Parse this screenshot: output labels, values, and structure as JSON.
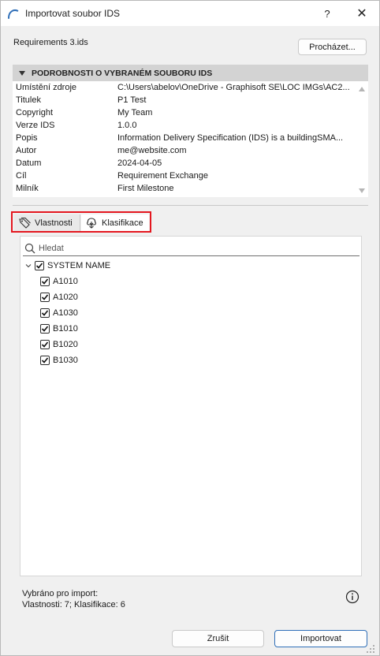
{
  "window": {
    "title": "Importovat soubor IDS",
    "help_label": "?",
    "close_label": "✕"
  },
  "file": {
    "name": "Requirements 3.ids",
    "browse_label": "Procházet..."
  },
  "details": {
    "header": "PODROBNOSTI O VYBRANÉM SOUBORU IDS",
    "rows": [
      {
        "key": "Umístění zdroje",
        "value": "C:\\Users\\abelov\\OneDrive - Graphisoft SE\\LOC IMGs\\AC2..."
      },
      {
        "key": "Titulek",
        "value": "P1 Test"
      },
      {
        "key": "Copyright",
        "value": "My Team"
      },
      {
        "key": "Verze IDS",
        "value": "1.0.0"
      },
      {
        "key": "Popis",
        "value": "Information Delivery Specification (IDS) is a buildingSMA..."
      },
      {
        "key": "Autor",
        "value": "me@website.com"
      },
      {
        "key": "Datum",
        "value": "2024-04-05"
      },
      {
        "key": "Cíl",
        "value": "Requirement Exchange"
      },
      {
        "key": "Milník",
        "value": "First Milestone"
      }
    ]
  },
  "tabs": [
    {
      "label": "Vlastnosti",
      "icon": "tag-icon",
      "active": false
    },
    {
      "label": "Klasifikace",
      "icon": "classification-tree-icon",
      "active": true
    }
  ],
  "search": {
    "placeholder": "Hledat",
    "value": ""
  },
  "tree": {
    "root": {
      "label": "SYSTEM NAME",
      "checked": true,
      "expanded": true
    },
    "items": [
      {
        "label": "A1010",
        "checked": true
      },
      {
        "label": "A1020",
        "checked": true
      },
      {
        "label": "A1030",
        "checked": true
      },
      {
        "label": "B1010",
        "checked": true
      },
      {
        "label": "B1020",
        "checked": true
      },
      {
        "label": "B1030",
        "checked": true
      }
    ]
  },
  "summary": {
    "line1": "Vybráno pro import:",
    "line2": "Vlastnosti: 7; Klasifikace: 6"
  },
  "buttons": {
    "cancel": "Zrušit",
    "import": "Importovat"
  },
  "colors": {
    "highlight": "#e4171f",
    "primary_border": "#2f6fb8",
    "header_bg": "#d3d3d3",
    "window_bg": "#f0f0f0"
  }
}
